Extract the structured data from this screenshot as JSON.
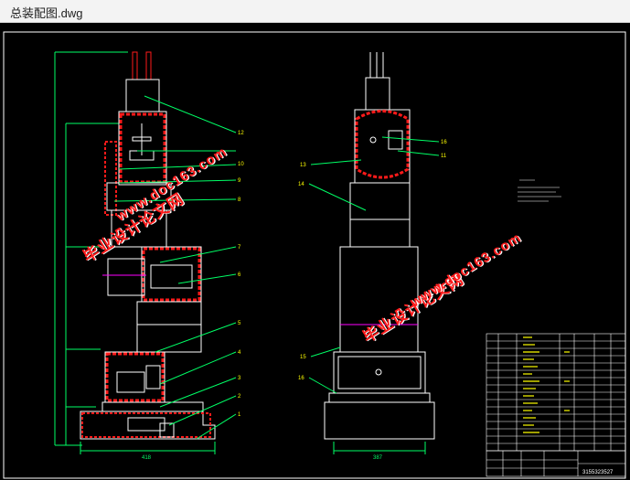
{
  "window": {
    "title": "总装配图.dwg"
  },
  "colors": {
    "background": "#000000",
    "frame": "#ffffff",
    "part_outline": "#ffffff",
    "highlight": "#ff1a1a",
    "leader": "#00ff66",
    "dimension": "#00ff66",
    "center_line": "#ff00ff",
    "yellow": "#ffff00",
    "watermark": "#ff1b1b"
  },
  "watermarks": {
    "cn_text": "毕业设计论文网",
    "url_text": "www.doc163.com"
  },
  "left_view": {
    "balloons": [
      "12",
      "10",
      "9",
      "8",
      "7",
      "6",
      "5",
      "4",
      "3",
      "2",
      "1"
    ],
    "dimensions": {
      "bottom_width": "418"
    }
  },
  "right_view": {
    "balloons": [
      "16",
      "11",
      "13",
      "14",
      "15",
      "16"
    ],
    "dimensions": {
      "bottom_width": "387"
    }
  },
  "title_block": {
    "drawing_number": "3155323527"
  }
}
